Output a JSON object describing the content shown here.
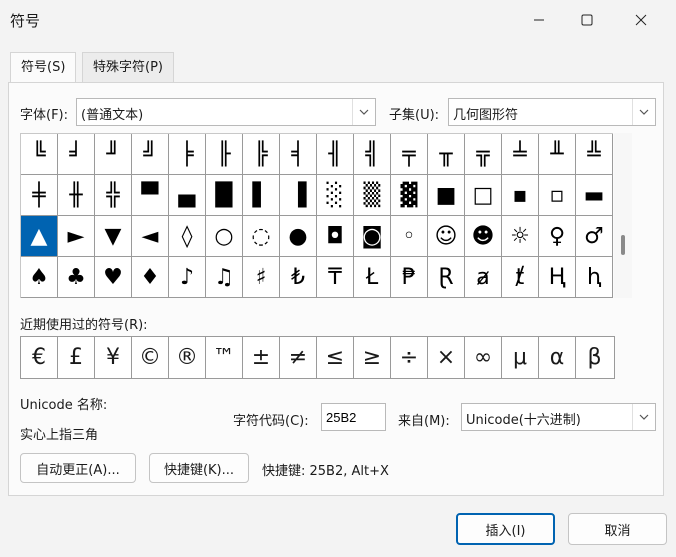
{
  "window": {
    "title": "符号",
    "minimize_icon": "minimize-icon",
    "maximize_icon": "maximize-icon",
    "close_icon": "close-icon"
  },
  "tabs": [
    {
      "label": "符号(S)",
      "active": true
    },
    {
      "label": "特殊字符(P)",
      "active": false
    }
  ],
  "font": {
    "label": "字体(F):",
    "value": "(普通文本)"
  },
  "subset": {
    "label": "子集(U):",
    "value": "几何图形符"
  },
  "symbol_grid": {
    "rows": [
      [
        "╚",
        "╛",
        "╜",
        "╝",
        "╞",
        "╟",
        "╠",
        "╡",
        "╢",
        "╣",
        "╤",
        "╥",
        "╦",
        "╧",
        "╨",
        "╩"
      ],
      [
        "╪",
        "╫",
        "╬",
        "▀",
        "▄",
        "█",
        "▌",
        "▐",
        "░",
        "▒",
        "▓",
        "■",
        "□",
        "▪",
        "▫",
        "▬"
      ],
      [
        "▲",
        "►",
        "▼",
        "◄",
        "◊",
        "○",
        "◌",
        "●",
        "◘",
        "◙",
        "◦",
        "☺",
        "☻",
        "☼",
        "♀",
        "♂"
      ],
      [
        "♠",
        "♣",
        "♥",
        "♦",
        "♪",
        "♫",
        "♯",
        "₺",
        "₸",
        "Ł",
        "₱",
        "Ɽ",
        "ⱥ",
        "ⱦ",
        "Ⱨ",
        "ⱨ"
      ]
    ],
    "selected": "▲"
  },
  "recent": {
    "label": "近期使用过的符号(R):",
    "symbols": [
      "€",
      "£",
      "¥",
      "©",
      "®",
      "™",
      "±",
      "≠",
      "≤",
      "≥",
      "÷",
      "×",
      "∞",
      "μ",
      "α",
      "β"
    ]
  },
  "unicode": {
    "name_label": "Unicode 名称:",
    "name_value": "实心上指三角"
  },
  "char_code": {
    "label": "字符代码(C):",
    "value": "25B2"
  },
  "from": {
    "label": "来自(M):",
    "value": "Unicode(十六进制)"
  },
  "buttons": {
    "autocorrect": "自动更正(A)...",
    "shortcut_key": "快捷键(K)...",
    "insert": "插入(I)",
    "cancel": "取消"
  },
  "shortcut": {
    "text": "快捷键: 25B2, Alt+X"
  },
  "colors": {
    "accent": "#0063b1",
    "background": "#f3f3f3",
    "panel": "#fbfbfb"
  }
}
